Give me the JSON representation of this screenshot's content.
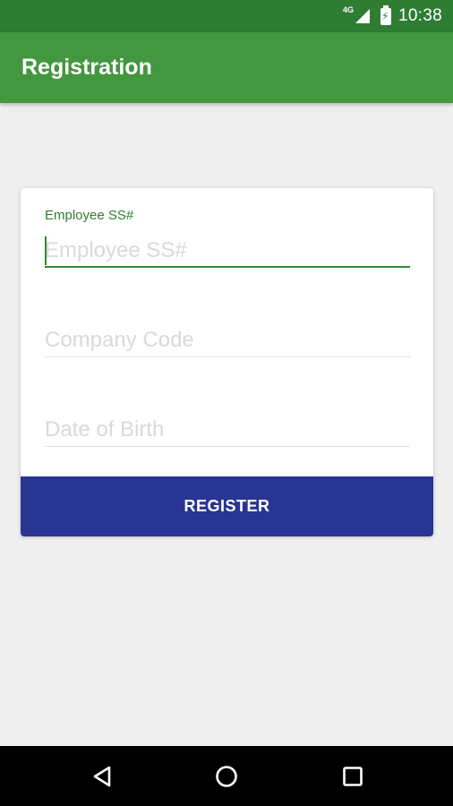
{
  "status_bar": {
    "network": "4G",
    "time": "10:38"
  },
  "app_bar": {
    "title": "Registration"
  },
  "form": {
    "fields": [
      {
        "label": "Employee SS#",
        "placeholder": "Employee SS#",
        "value": ""
      },
      {
        "label": "Company Code",
        "placeholder": "Company Code",
        "value": ""
      },
      {
        "label": "Date of Birth",
        "placeholder": "Date of Birth",
        "value": ""
      }
    ],
    "register_label": "REGISTER"
  },
  "nav_bar": {
    "icons": [
      "back-icon",
      "home-icon",
      "recents-icon"
    ]
  },
  "colors": {
    "status_bar": "#2e7d32",
    "app_bar": "#43973f",
    "accent": "#2e8b2e",
    "button": "#283593",
    "background": "#efefef"
  }
}
